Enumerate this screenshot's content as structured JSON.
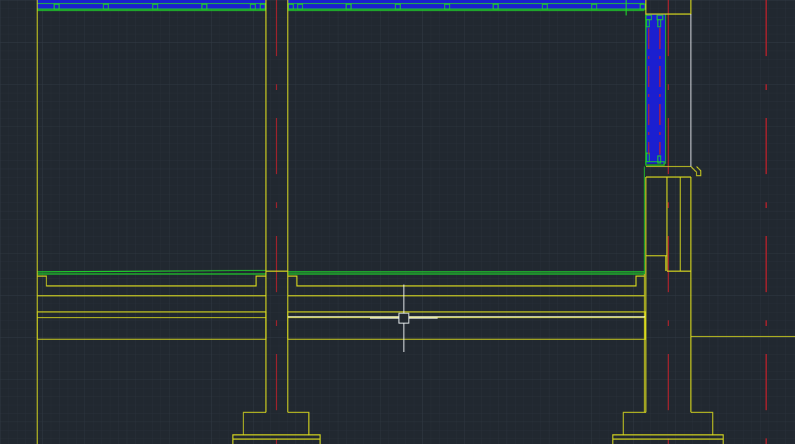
{
  "app": {
    "view": "model-space"
  },
  "colors": {
    "background": "#212830",
    "grid_minor": "#29313a",
    "grid_major": "#323b46",
    "outline": "#d8d81e",
    "insulation": "#1fcf2a",
    "wall_fill": "#1b1fd0",
    "centerline": "#c0202a",
    "white_line": "#dfe3e8",
    "cursor": "#eef2f5"
  },
  "layers": {
    "grid": "grid",
    "structure": "structure",
    "insulation": "insulation",
    "centerlines": "centerlines",
    "cursor": "crosshair"
  }
}
